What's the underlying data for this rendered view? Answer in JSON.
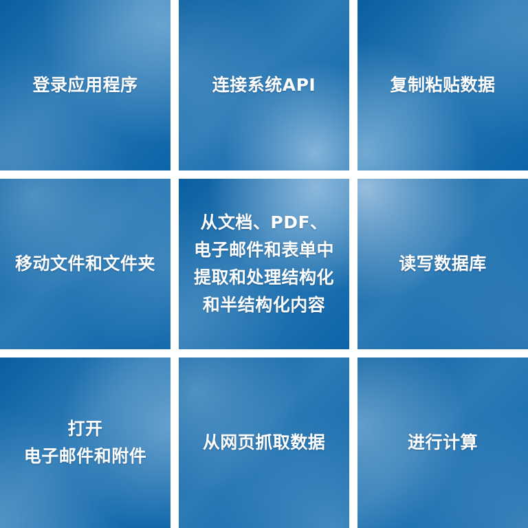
{
  "colors": {
    "tile_base": "#0a5fa0",
    "tile_mid": "#2d7bb6",
    "tile_highlight": "#b4d2eb",
    "gap": "#ffffff",
    "text": "#ffffff"
  },
  "tiles": [
    {
      "label": "登录应用程序"
    },
    {
      "label": "连接系统API"
    },
    {
      "label": "复制粘贴数据"
    },
    {
      "label": "移动文件和文件夹"
    },
    {
      "label": "从文档、PDF、\n电子邮件和表单中\n提取和处理结构化\n和半结构化内容"
    },
    {
      "label": "读写数据库"
    },
    {
      "label": "打开\n电子邮件和附件"
    },
    {
      "label": "从网页抓取数据"
    },
    {
      "label": "进行计算"
    }
  ]
}
